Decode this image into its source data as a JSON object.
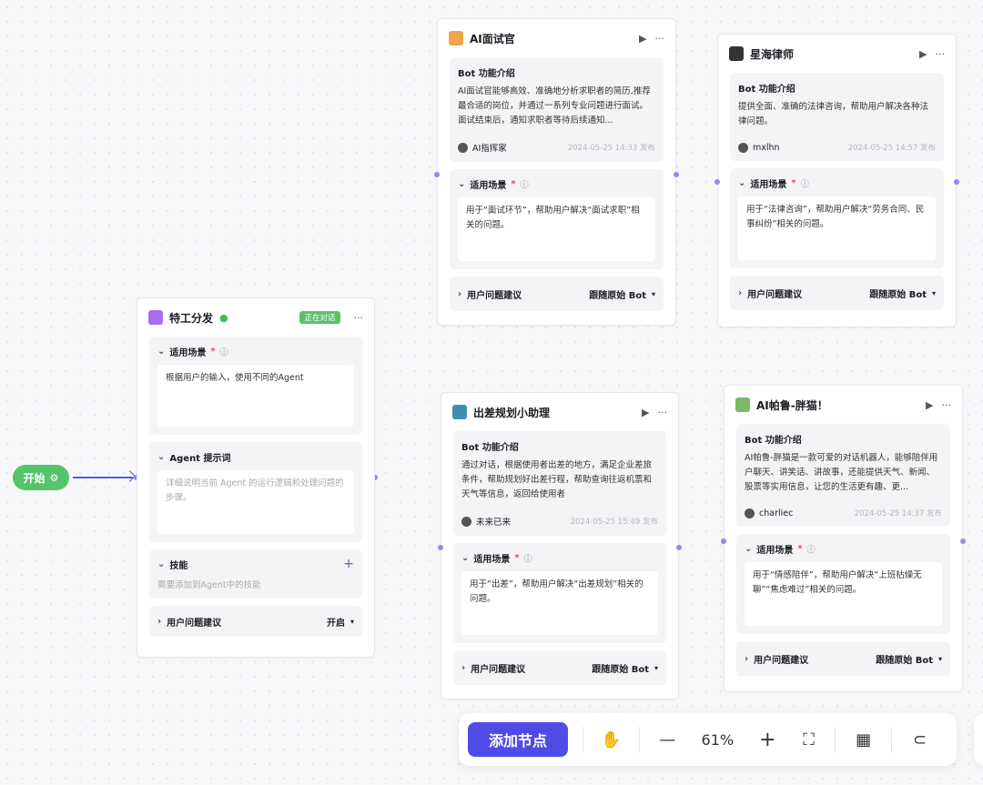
{
  "start": {
    "label": "开始"
  },
  "agent": {
    "title": "特工分发",
    "badge": "正在对话",
    "scene_label": "适用场景",
    "scene_text": "根据用户的输入，使用不同的Agent",
    "prompt_label": "Agent 提示词",
    "prompt_placeholder": "详细说明当前 Agent 的运行逻辑和处理问题的步骤。",
    "skill_label": "技能",
    "skill_hint": "需要添加到Agent中的技能",
    "suggest_label": "用户问题建议",
    "suggest_value": "开启"
  },
  "cards": [
    {
      "title": "AI面试官",
      "intro_title": "Bot 功能介绍",
      "intro": "AI面试官能够高效、准确地分析求职者的简历,推荐最合适的岗位，并通过一系列专业问题进行面试。面试结束后，通知求职者等待后续通知...",
      "author": "AI指挥家",
      "date": "2024-05-25 14:33 发布",
      "scene_label": "适用场景",
      "scene_text": "用于“面试环节”，帮助用户解决“面试求职”相关的问题。",
      "suggest_label": "用户问题建议",
      "suggest_value": "跟随原始 Bot"
    },
    {
      "title": "星海律师",
      "intro_title": "Bot 功能介绍",
      "intro": "提供全面、准确的法律咨询，帮助用户解决各种法律问题。",
      "author": "mxlhn",
      "date": "2024-05-25 14:57 发布",
      "scene_label": "适用场景",
      "scene_text": "用于“法律咨询”，帮助用户解决“劳务合同、民事纠纷”相关的问题。",
      "suggest_label": "用户问题建议",
      "suggest_value": "跟随原始 Bot"
    },
    {
      "title": "出差规划小助理",
      "intro_title": "Bot 功能介绍",
      "intro": "通过对话，根据使用者出差的地方，满足企业差旅条件，帮助规划好出差行程，帮助查询往返机票和天气等信息，返回给使用者",
      "author": "未来已来",
      "date": "2024-05-25 15:49 发布",
      "scene_label": "适用场景",
      "scene_text": "用于“出差”，帮助用户解决“出差规划”相关的问题。",
      "suggest_label": "用户问题建议",
      "suggest_value": "跟随原始 Bot"
    },
    {
      "title": "AI帕鲁-胖猫！",
      "intro_title": "Bot 功能介绍",
      "intro": "AI帕鲁-胖猫是一款可爱的对话机器人，能够陪伴用户聊天、讲笑话、讲故事，还能提供天气、新闻、股票等实用信息，让您的生活更有趣、更...",
      "author": "charliec",
      "date": "2024-05-25 14:37 发布",
      "scene_label": "适用场景",
      "scene_text": "用于“情感陪伴”，帮助用户解决“上班枯燥无聊”“焦虑难过”相关的问题。",
      "suggest_label": "用户问题建议",
      "suggest_value": "跟随原始 Bot"
    }
  ],
  "toolbar": {
    "add_node": "添加节点",
    "zoom": "61%"
  },
  "colors": {
    "accent": "#4f4ce6",
    "start": "#54c56b"
  }
}
